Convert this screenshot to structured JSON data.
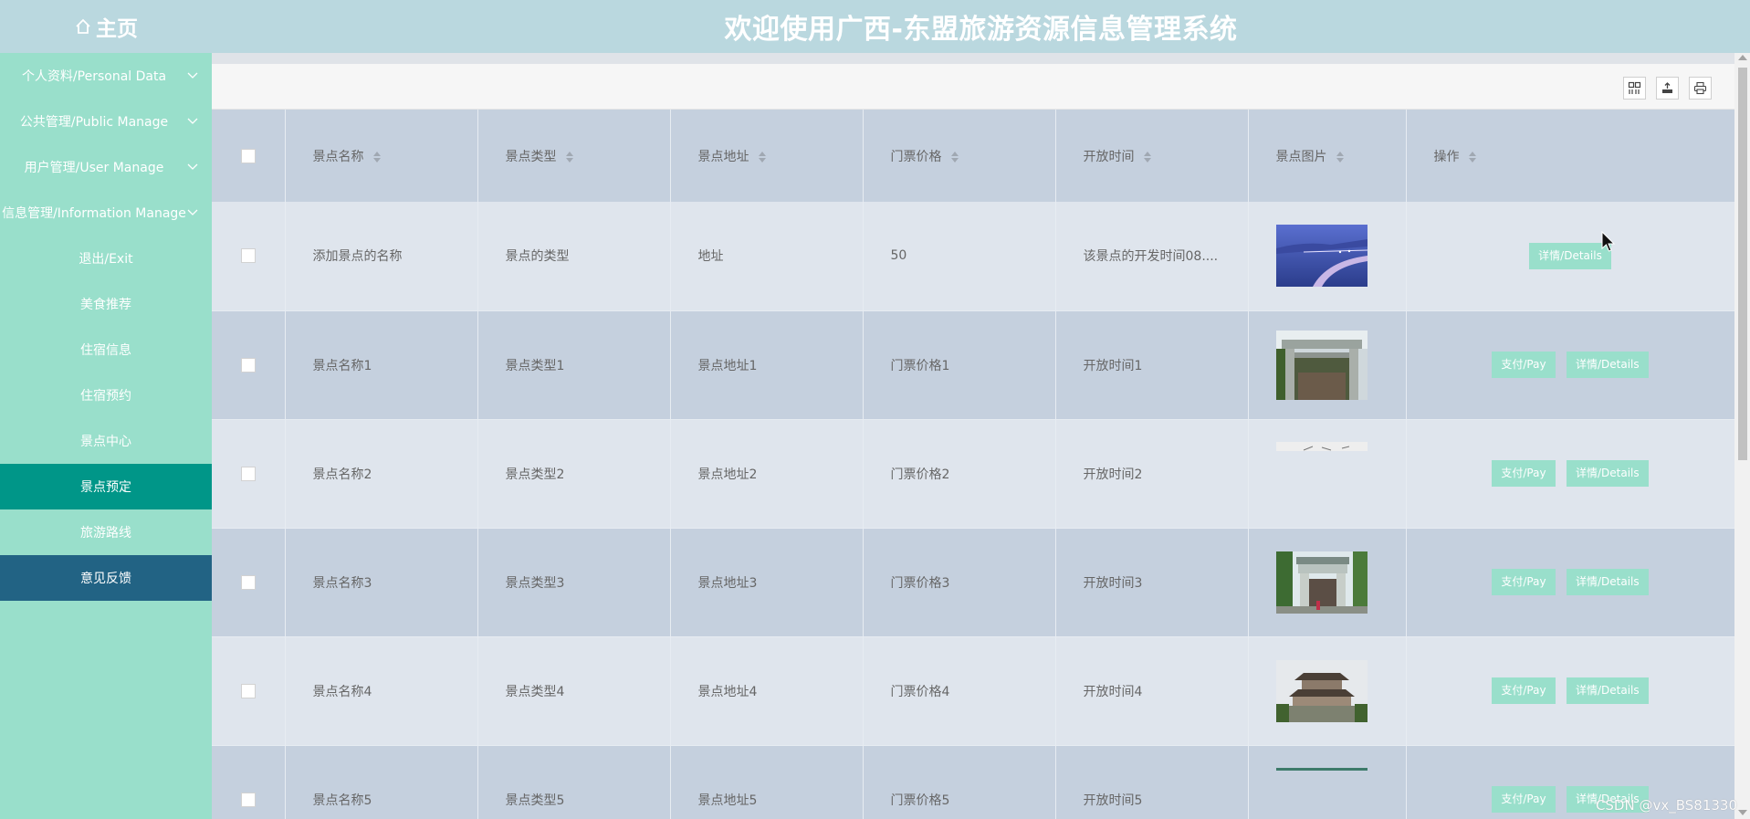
{
  "header": {
    "home_label": "主页",
    "title": "欢迎使用广西-东盟旅游资源信息管理系统"
  },
  "sidebar": {
    "items": [
      {
        "label": "个人资料/Personal Data",
        "expandable": true
      },
      {
        "label": "公共管理/Public Manage",
        "expandable": true
      },
      {
        "label": "用户管理/User Manage",
        "expandable": true
      },
      {
        "label": "信息管理/Information Manage",
        "expandable": true
      },
      {
        "label": "退出/Exit"
      },
      {
        "label": "美食推荐"
      },
      {
        "label": "住宿信息"
      },
      {
        "label": "住宿预约"
      },
      {
        "label": "景点中心"
      },
      {
        "label": "景点预定",
        "active": true
      },
      {
        "label": "旅游路线"
      },
      {
        "label": "意见反馈"
      }
    ]
  },
  "toolbar": {
    "icons": [
      "columns-icon",
      "export-icon",
      "print-icon"
    ]
  },
  "table": {
    "headers": [
      "景点名称",
      "景点类型",
      "景点地址",
      "门票价格",
      "开放时间",
      "景点图片",
      "操作"
    ],
    "rows": [
      {
        "name": "添加景点的名称",
        "type": "景点的类型",
        "address": "地址",
        "price": "50",
        "open_time": "该景点的开发时间08....",
        "image": "bridge-night-photo",
        "actions": [
          "详情/Details"
        ]
      },
      {
        "name": "景点名称1",
        "type": "景点类型1",
        "address": "景点地址1",
        "price": "门票价格1",
        "open_time": "开放时间1",
        "image": "archway-photo",
        "actions": [
          "支付/Pay",
          "详情/Details"
        ]
      },
      {
        "name": "景点名称2",
        "type": "景点类型2",
        "address": "景点地址2",
        "price": "门票价格2",
        "open_time": "开放时间2",
        "image": "partial-photo",
        "actions": [
          "支付/Pay",
          "详情/Details"
        ]
      },
      {
        "name": "景点名称3",
        "type": "景点类型3",
        "address": "景点地址3",
        "price": "门票价格3",
        "open_time": "开放时间3",
        "image": "gate-photo",
        "actions": [
          "支付/Pay",
          "详情/Details"
        ]
      },
      {
        "name": "景点名称4",
        "type": "景点类型4",
        "address": "景点地址4",
        "price": "门票价格4",
        "open_time": "开放时间4",
        "image": "tower-photo",
        "actions": [
          "支付/Pay",
          "详情/Details"
        ]
      },
      {
        "name": "景点名称5",
        "type": "景点类型5",
        "address": "景点地址5",
        "price": "门票价格5",
        "open_time": "开放时间5",
        "image": "partial-photo",
        "actions": [
          "支付/Pay",
          "详情/Details"
        ]
      }
    ]
  },
  "watermark": "CSDN @vx_BS81330",
  "colors": {
    "header_bg": "#bad8df",
    "sidebar_bg": "#99dfcb",
    "active_item": "#009688",
    "feedback_item": "#226384",
    "button_bg": "#99dfcb",
    "row_light": "#dfe5ed",
    "row_dark": "#c5d0de"
  }
}
